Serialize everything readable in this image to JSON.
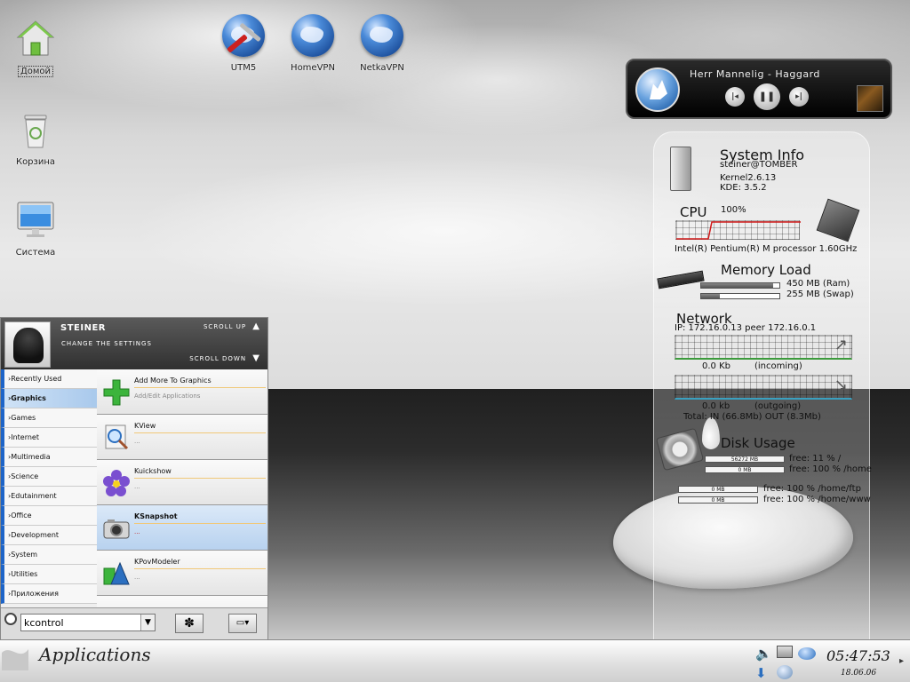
{
  "desktop_icons": [
    {
      "id": "home",
      "label": "Домой"
    },
    {
      "id": "trash",
      "label": "Корзина"
    },
    {
      "id": "system",
      "label": "Система"
    },
    {
      "id": "utm5",
      "label": "UTM5"
    },
    {
      "id": "homevpn",
      "label": "HomeVPN"
    },
    {
      "id": "netkavpn",
      "label": "NetkaVPN"
    }
  ],
  "player": {
    "track": "Herr Mannelig - Haggard",
    "prev_icon": "skip-previous-icon",
    "pause_icon": "pause-icon",
    "next_icon": "skip-next-icon"
  },
  "monitor": {
    "system_info": {
      "title": "System Info",
      "user": "steiner@TOMBER",
      "kernel": "Kernel2.6.13",
      "kde": "KDE: 3.5.2"
    },
    "cpu": {
      "title": "CPU",
      "load": "100%",
      "model": "Intel(R) Pentium(R) M processor 1.60GHz"
    },
    "memory": {
      "title": "Memory Load",
      "ram": "450 MB (Ram)",
      "swap": "255 MB (Swap)",
      "ram_fraction": 0.92,
      "swap_fraction": 0.24
    },
    "network": {
      "title": "Network",
      "ip": "IP:  172.16.0.13 peer 172.16.0.1",
      "incoming_value": "0.0 Kb",
      "incoming_label": "(incoming)",
      "outgoing_value": "0.0 kb",
      "outgoing_label": "(outgoing)",
      "total": "Total: IN (66.8Mb)  OUT   (8.3Mb)"
    },
    "disk": {
      "title": "Disk Usage",
      "entries": [
        {
          "used": "56272 MB",
          "free": "free:  11 % /",
          "used_fraction": 0.89
        },
        {
          "used": "0 MB",
          "free": "free:  100 % /home",
          "used_fraction": 0
        },
        {
          "used": "0 MB",
          "free": "free:  100 % /home/ftp",
          "used_fraction": 0
        },
        {
          "used": "0 MB",
          "free": "free:  100 % /home/www",
          "used_fraction": 0
        }
      ]
    }
  },
  "kmenu": {
    "user": "STEINER",
    "change_settings": "CHANGE THE SETTINGS",
    "scroll_up": "SCROLL UP",
    "scroll_down": "SCROLL DOWN",
    "categories": [
      "Recently Used",
      "Graphics",
      "Games",
      "Internet",
      "Multimedia",
      "Science",
      "Edutainment",
      "Office",
      "Development",
      "System",
      "Utilities",
      "Приложения"
    ],
    "active_category": "Graphics",
    "apps": [
      {
        "name": "Add More To Graphics",
        "desc": "Add/Edit Applications",
        "icon": "plus-icon"
      },
      {
        "name": "KView",
        "desc": "...",
        "icon": "image-viewer-icon"
      },
      {
        "name": "Kuickshow",
        "desc": "...",
        "icon": "flower-icon"
      },
      {
        "name": "KSnapshot",
        "desc": "...",
        "icon": "camera-icon"
      },
      {
        "name": "KPovModeler",
        "desc": "...",
        "icon": "shapes-icon"
      }
    ],
    "active_app": "KSnapshot",
    "search_value": "kcontrol"
  },
  "taskbar": {
    "start_label": "Applications",
    "time": "05:47:53",
    "date": "18.06.06"
  }
}
